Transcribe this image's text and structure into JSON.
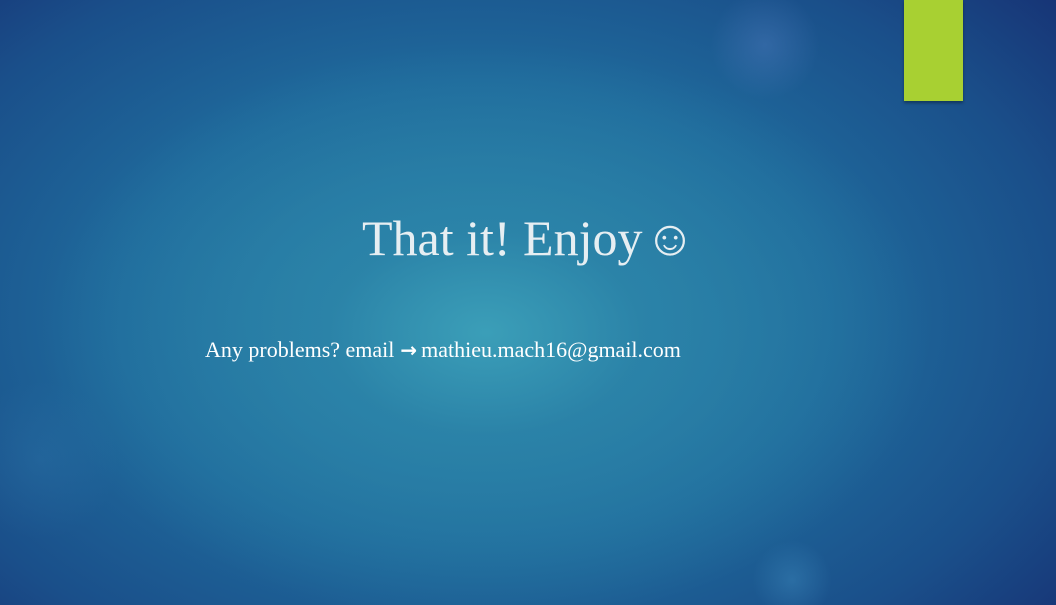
{
  "slide": {
    "title": "That it! Enjoy",
    "title_emoticon": "☺",
    "subtitle_prefix": "Any problems? email",
    "subtitle_arrow": "→",
    "subtitle_email": "mathieu.mach16@gmail.com"
  },
  "colors": {
    "accent": "#a8d032",
    "title_text": "#e6eef2",
    "body_text": "#ffffff",
    "background_center": "#3aa0b8",
    "background_edge": "#162f72"
  }
}
